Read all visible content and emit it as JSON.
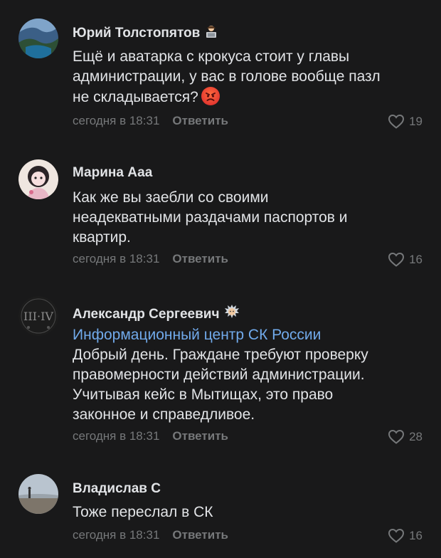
{
  "comments": [
    {
      "author": "Юрий Толстопятов",
      "author_emoji": "laptop-person-icon",
      "lines": [
        "Ещё и аватарка с крокуса стоит у главы",
        "администрации, у вас в голове вообще пазл",
        "не складывается?"
      ],
      "text_emoji": "angry-face-icon",
      "time": "сегодня в 18:31",
      "reply": "Ответить",
      "likes": "19"
    },
    {
      "author": "Марина Ааа",
      "lines": [
        "Как же вы заебли со своими",
        "неадекватными раздачами паспортов и",
        "квартир."
      ],
      "time": "сегодня в 18:31",
      "reply": "Ответить",
      "likes": "16"
    },
    {
      "author": "Александр Сергеевич",
      "author_emoji": "dizzy-face-icon",
      "mention": "Информационный центр СК России",
      "lines": [
        "Добрый день. Граждане требуют проверку",
        "правомерности действий администрации.",
        "Учитывая кейс в Мытищах, это право",
        "законное и справедливое."
      ],
      "time": "сегодня в 18:31",
      "reply": "Ответить",
      "likes": "28"
    },
    {
      "author": "Владислав С",
      "lines": [
        "Тоже переслал в СК"
      ],
      "time": "сегодня в 18:31",
      "reply": "Ответить",
      "likes": "16"
    }
  ],
  "colors": {
    "background": "#19191a",
    "text": "#e1e3e6",
    "secondary": "#76787a",
    "link": "#71aaeb"
  }
}
